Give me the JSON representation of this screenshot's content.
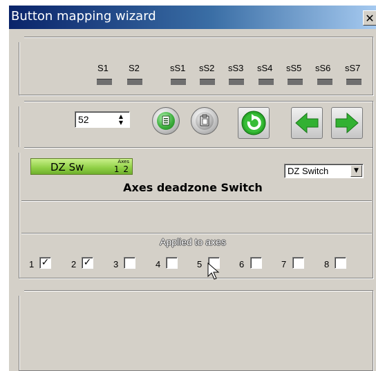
{
  "window": {
    "title": "Button mapping wizard",
    "close_glyph": "✕"
  },
  "shift_labels": [
    "S1",
    "S2",
    "sS1",
    "sS2",
    "sS3",
    "sS4",
    "sS5",
    "sS6",
    "sS7"
  ],
  "controls": {
    "spin_value": "52",
    "copy_icon": "copy-icon",
    "paste_icon": "paste-icon",
    "refresh_icon": "refresh-icon",
    "back_icon": "arrow-left-icon",
    "forward_icon": "arrow-right-icon"
  },
  "function": {
    "button_label": "DZ Sw",
    "axes_caption": "Axes",
    "axes_numbers": "1 2",
    "dropdown_value": "DZ Switch",
    "title": "Axes deadzone Switch"
  },
  "axes": {
    "label": "Applied to axes",
    "items": [
      {
        "num": "1",
        "checked": true
      },
      {
        "num": "2",
        "checked": true
      },
      {
        "num": "3",
        "checked": false
      },
      {
        "num": "4",
        "checked": false
      },
      {
        "num": "5",
        "checked": false
      },
      {
        "num": "6",
        "checked": false
      },
      {
        "num": "7",
        "checked": false
      },
      {
        "num": "8",
        "checked": false
      }
    ]
  },
  "colors": {
    "title_bar": "#0a246a",
    "face": "#d4d0c8",
    "accent_green": "#2fa82f"
  }
}
